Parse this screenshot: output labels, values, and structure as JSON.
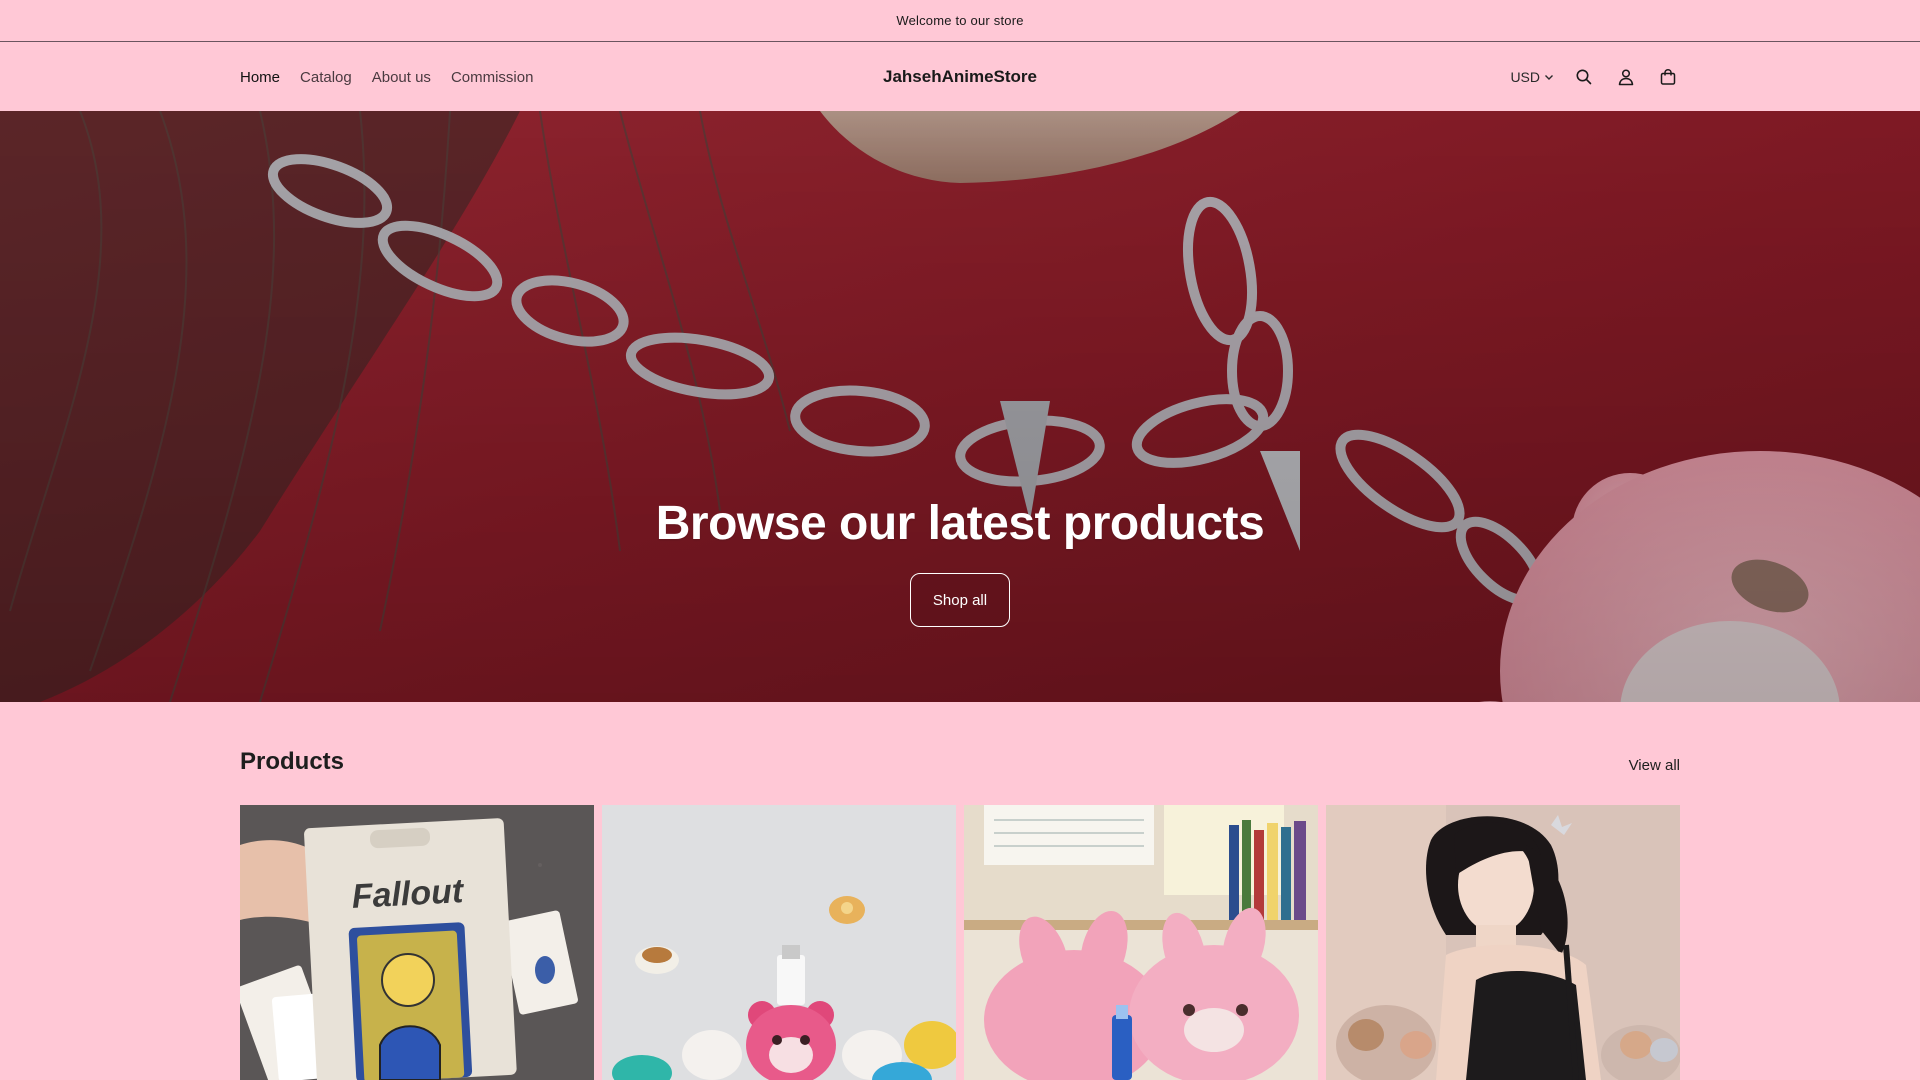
{
  "announcement": {
    "text": "Welcome to our store"
  },
  "header": {
    "nav": [
      {
        "label": "Home"
      },
      {
        "label": "Catalog"
      },
      {
        "label": "About us"
      },
      {
        "label": "Commission"
      }
    ],
    "logo": "JahsehAnimeStore",
    "currency": "USD",
    "icons": [
      "search-icon",
      "account-icon",
      "cart-icon"
    ]
  },
  "hero": {
    "title": "Browse our latest products",
    "button_label": "Shop all"
  },
  "products": {
    "title": "Products",
    "view_all_label": "View all",
    "cards": [
      {
        "image": "fallout-playing-cards"
      },
      {
        "image": "pink-bear-cable-protectors"
      },
      {
        "image": "pink-bear-plush-slippers"
      },
      {
        "image": "model-photo"
      }
    ]
  },
  "colors": {
    "background": "#ffc8d6",
    "hero_overlay": "#8e1f2a",
    "text": "#121212"
  }
}
